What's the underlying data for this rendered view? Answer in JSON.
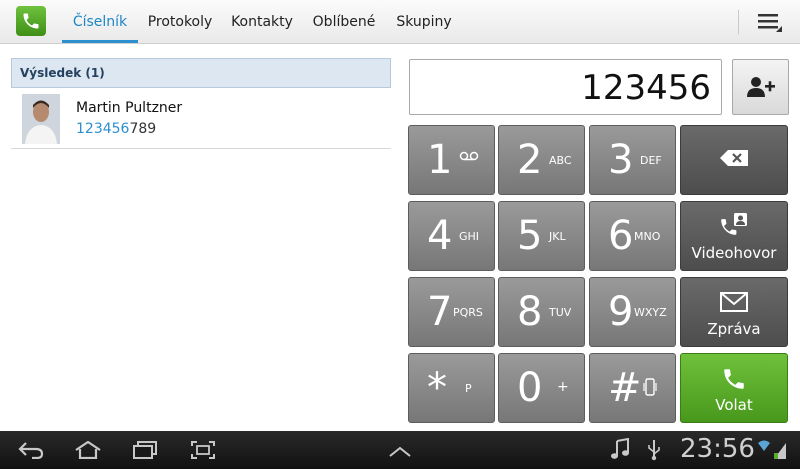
{
  "tabs": [
    {
      "label": "Číselník"
    },
    {
      "label": "Protokoly"
    },
    {
      "label": "Kontakty"
    },
    {
      "label": "Oblíbené"
    },
    {
      "label": "Skupiny"
    }
  ],
  "result_header": "Výsledek (1)",
  "contact": {
    "name": "Martin Pultzner",
    "number_match": "123456",
    "number_rest": "789"
  },
  "dial_number": "123456",
  "keys": [
    {
      "digit": "1",
      "letters": "∞"
    },
    {
      "digit": "2",
      "letters": "ABC"
    },
    {
      "digit": "3",
      "letters": "DEF"
    },
    {
      "digit": "4",
      "letters": "GHI"
    },
    {
      "digit": "5",
      "letters": "JKL"
    },
    {
      "digit": "6",
      "letters": "MNO"
    },
    {
      "digit": "7",
      "letters": "PQRS"
    },
    {
      "digit": "8",
      "letters": "TUV"
    },
    {
      "digit": "9",
      "letters": "WXYZ"
    },
    {
      "digit": "*",
      "letters": "P"
    },
    {
      "digit": "0",
      "letters": "+"
    },
    {
      "digit": "#",
      "letters": ""
    }
  ],
  "function_keys": {
    "video": "Videohovor",
    "message": "Zpráva",
    "call": "Volat"
  },
  "status": {
    "clock": "23:56"
  },
  "colors": {
    "accent": "#2b8fd0",
    "call_green": "#5aab2a"
  }
}
